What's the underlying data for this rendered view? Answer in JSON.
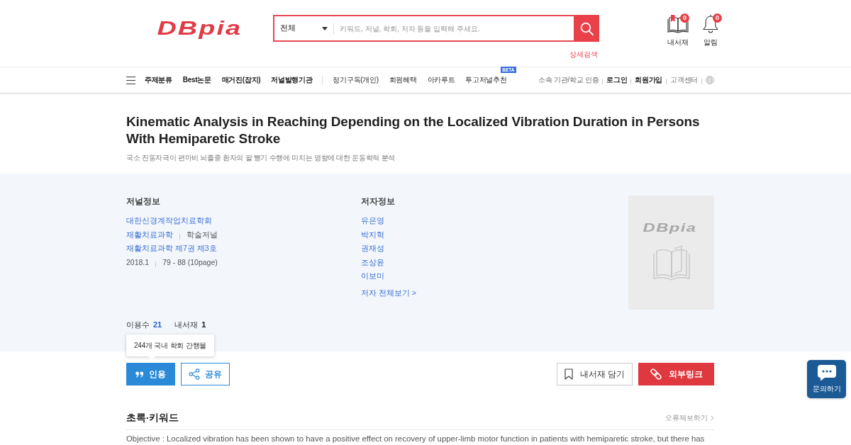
{
  "header": {
    "logo": "DBpia",
    "search": {
      "scope": "전체",
      "placeholder": "키워드, 저널, 학회, 저자 등을 입력해 주세요."
    },
    "advanced_search": "상세검색",
    "shortcuts": [
      {
        "label": "내서재",
        "count": "0"
      },
      {
        "label": "알림",
        "count": "0"
      }
    ]
  },
  "nav": {
    "menu": [
      {
        "label": "주제분류"
      },
      {
        "label": "Best논문"
      },
      {
        "label": "매거진(잡지)"
      },
      {
        "label": "저널발행기관"
      }
    ],
    "services": [
      {
        "label": "정기구독(개인)"
      },
      {
        "label": "회원혜택"
      },
      {
        "label": "아카루트"
      },
      {
        "label": "투고저널추천",
        "badge": "BETA"
      }
    ],
    "account_links": [
      {
        "label": "소속 기관/학교 인증",
        "emphasized": false
      },
      {
        "label": "로그인",
        "emphasized": true
      },
      {
        "label": "회원가입",
        "emphasized": true
      },
      {
        "label": "고객센터",
        "emphasized": false
      }
    ]
  },
  "article": {
    "title": "Kinematic Analysis in Reaching Depending on the Localized Vibration Duration in Persons With Hemiparetic Stroke",
    "subtitle": "국소 진동자극이 편마비 뇌졸중 환자의 팔 뻗기 수행에 미치는 영향에 대한 운동학적 분석"
  },
  "journal_info": {
    "heading": "저널정보",
    "lines": [
      {
        "parts": [
          {
            "text": "대한신경계작업치료학회",
            "kind": "link"
          }
        ]
      },
      {
        "parts": [
          {
            "text": "재활치료과학",
            "kind": "link"
          },
          {
            "text": "학술저널",
            "kind": "text"
          }
        ]
      },
      {
        "parts": [
          {
            "text": "재활치료과학 제7권 제3호",
            "kind": "link"
          }
        ]
      },
      {
        "parts": [
          {
            "text": "2018.1",
            "kind": "text"
          },
          {
            "text": "79 - 88 (10page)",
            "kind": "text"
          }
        ]
      }
    ]
  },
  "author_info": {
    "heading": "저자정보",
    "authors": [
      "유은영",
      "박지혁",
      "권재성",
      "조상윤",
      "이보미"
    ],
    "more_link": "저자 전체보기 >"
  },
  "cover": {
    "logo": "DBpia"
  },
  "stats": [
    {
      "label": "이용수",
      "value": "21",
      "color": "#2d5fd2"
    },
    {
      "label": "내서재",
      "value": "1",
      "color": "#222222"
    }
  ],
  "tooltip": "244개 국내 학회 간행물",
  "actions": {
    "start": [
      {
        "label": "인용",
        "kind": "filled"
      },
      {
        "label": "공유",
        "kind": "outline"
      }
    ],
    "end": [
      {
        "label": "내서재 담기",
        "kind": "plain"
      },
      {
        "label": "외부링크",
        "kind": "accent"
      }
    ]
  },
  "abstract": {
    "heading": "초록·키워드",
    "report_link": "오류제보하기",
    "text": "Objective : Localized vibration has been shown to have a positive effect on recovery of upper-limb motor function in patients with hemiparetic stroke, but there has"
  },
  "chat_widget": {
    "label": "문의하기"
  }
}
